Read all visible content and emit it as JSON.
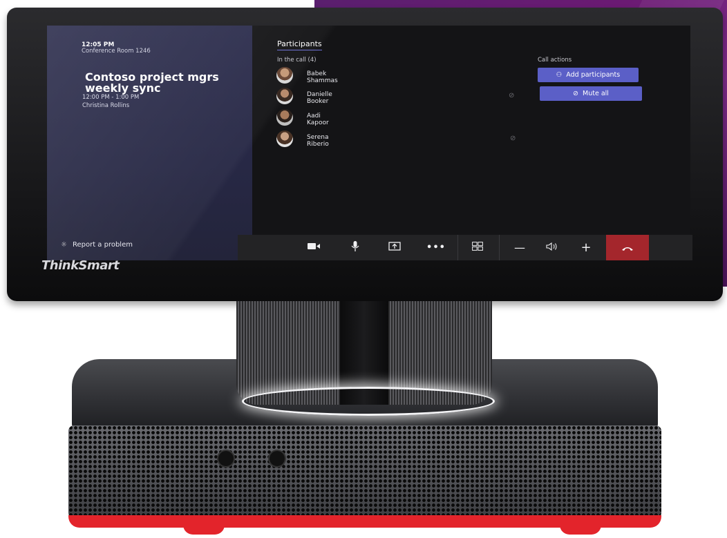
{
  "device": {
    "brand_logo": "ThinkSmart"
  },
  "meeting": {
    "time": "12:05 PM",
    "room": "Conference Room 1246",
    "title_line1": "Contoso project mgrs",
    "title_line2": "weekly sync",
    "time_range": "12:00 PM - 1:00 PM",
    "organizer": "Christina Rollins"
  },
  "report": {
    "label": "Report a problem"
  },
  "participants": {
    "tab_label": "Participants",
    "in_call_label": "In the call (4)",
    "list": [
      {
        "name": "Babek Shammas",
        "muted": false
      },
      {
        "name": "Danielle Booker",
        "muted": true
      },
      {
        "name": "Aadi Kapoor",
        "muted": false
      },
      {
        "name": "Serena Riberio",
        "muted": true
      }
    ]
  },
  "call_actions": {
    "heading": "Call actions",
    "add_participants": "Add participants",
    "mute_all": "Mute all"
  },
  "colors": {
    "accent": "#5b5fc7",
    "hangup": "#a4262c",
    "panel": "#2c2d4d"
  }
}
